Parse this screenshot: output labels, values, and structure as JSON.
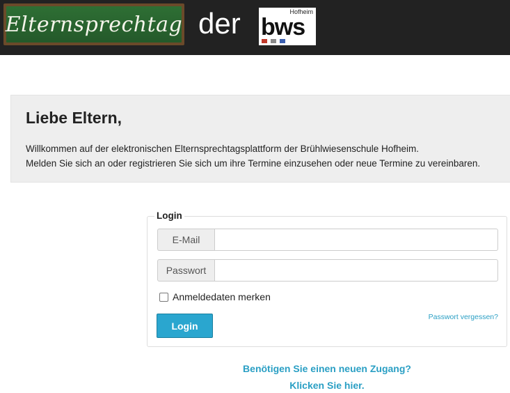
{
  "header": {
    "chalkboard_text": "Elternsprechtag",
    "connector": "der",
    "logo": {
      "city": "Hofheim",
      "word": "bws",
      "square_colors": [
        "#c0392b",
        "#8a8a8a",
        "#3b5fb0"
      ]
    }
  },
  "welcome": {
    "heading": "Liebe Eltern,",
    "line1": "Willkommen auf der elektronischen Elternsprechtagsplattform der Brühlwiesenschule Hofheim.",
    "line2": "Melden Sie sich an oder registrieren Sie sich um ihre Termine einzusehen oder neue Termine zu vereinbaren."
  },
  "login": {
    "legend": "Login",
    "email_label": "E-Mail",
    "email_value": "",
    "password_label": "Passwort",
    "password_value": "",
    "remember_label": "Anmeldedaten merken",
    "remember_checked": false,
    "forgot_link": "Passwort vergessen?",
    "submit_label": "Login"
  },
  "register": {
    "line1": "Benötigen Sie einen neuen Zugang?",
    "line2": "Klicken Sie hier."
  },
  "colors": {
    "header_bg": "#222222",
    "accent": "#2aa6cf",
    "link": "#2a9fc4"
  }
}
